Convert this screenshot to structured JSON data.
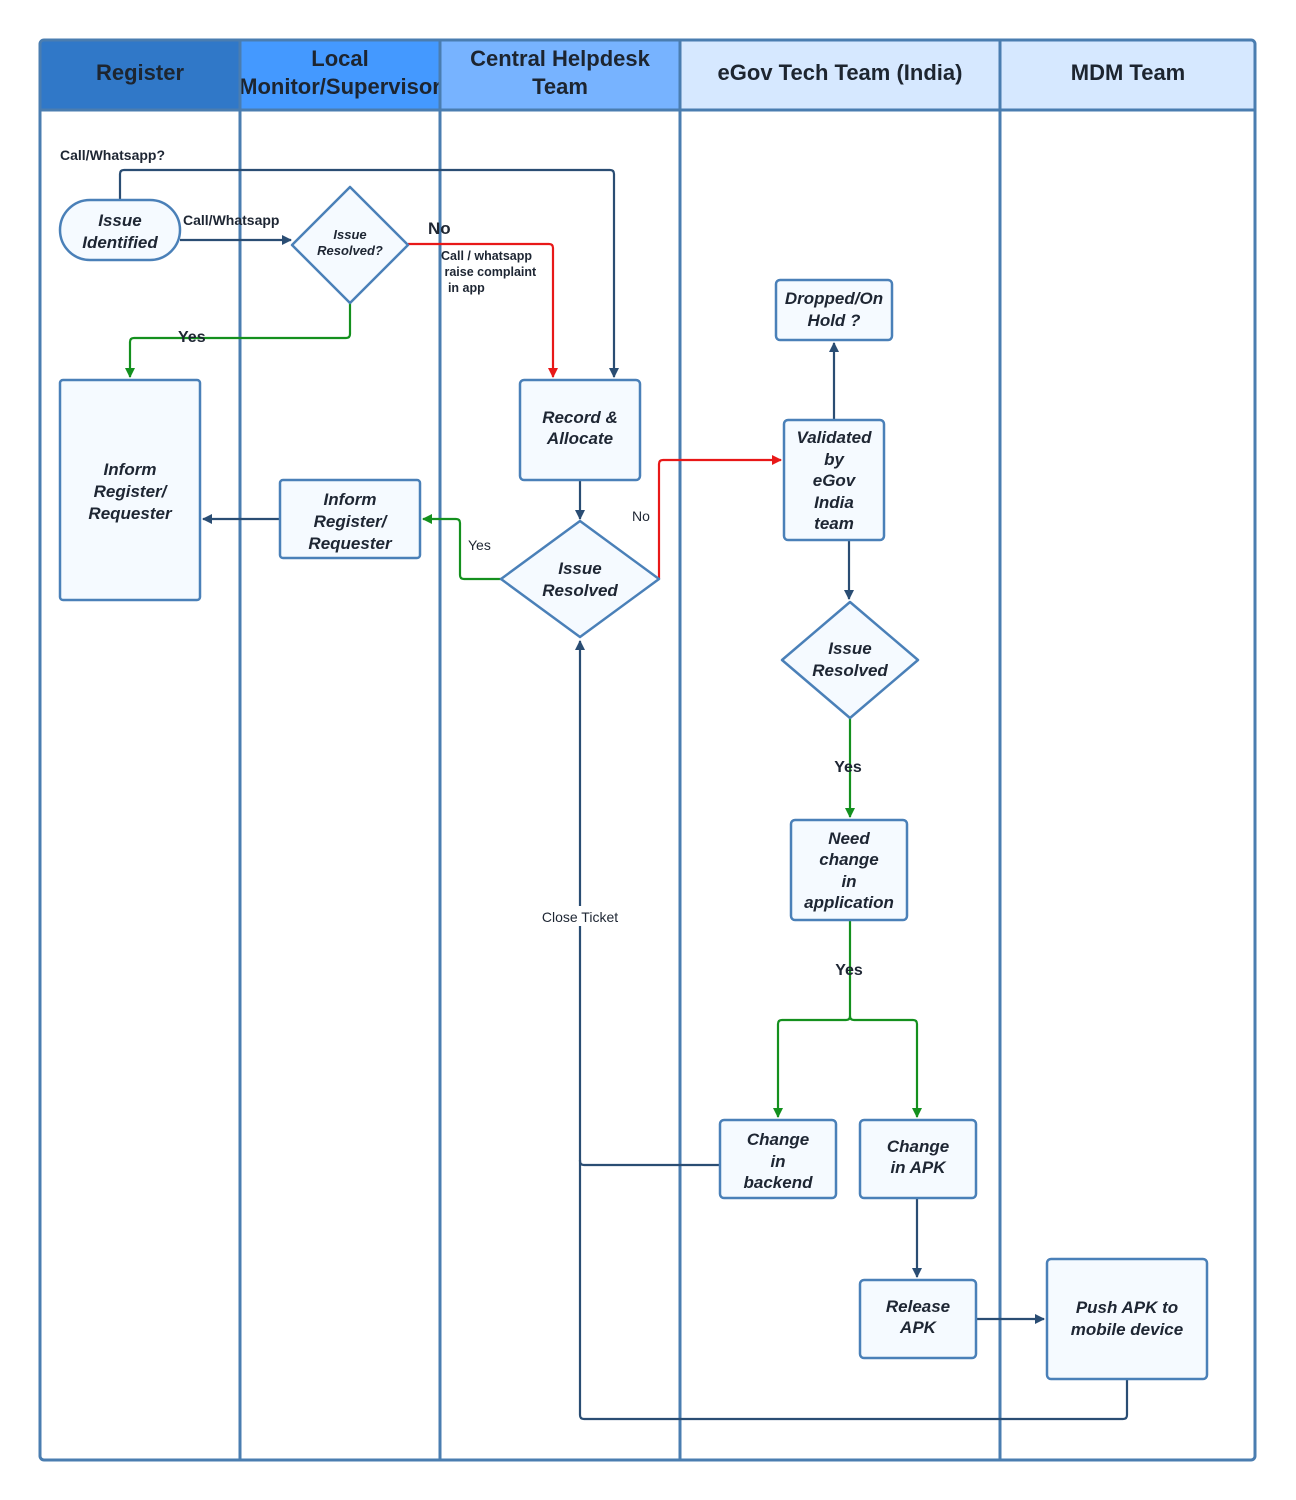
{
  "colors": {
    "header_register": "#3078C8",
    "header_local": "#4499FF",
    "header_central": "#77B3FF",
    "header_egov": "#D6E8FF",
    "header_mdm": "#D6E8FF",
    "lane_border": "#4A7DB0",
    "node_fill": "#F5FAFF",
    "connector_default": "#2A4D73",
    "connector_yes": "#14901E",
    "connector_no": "#E81818"
  },
  "lanes": [
    {
      "title_lines": [
        "Register"
      ]
    },
    {
      "title_lines": [
        "Local",
        "Monitor/Supervisor"
      ]
    },
    {
      "title_lines": [
        "Central Helpdesk",
        "Team"
      ]
    },
    {
      "title_lines": [
        "eGov Tech Team (India)"
      ]
    },
    {
      "title_lines": [
        "MDM Team"
      ]
    }
  ],
  "nodes": {
    "issue_identified": [
      "Issue",
      "Identified"
    ],
    "issue_resolved_local": [
      "Issue",
      "Resolved?"
    ],
    "inform_register_1": [
      "Inform",
      "Register/",
      "Requester"
    ],
    "record_allocate": [
      "Record &",
      "Allocate"
    ],
    "inform_register_2": [
      "Inform",
      "Register/",
      "Requester"
    ],
    "issue_resolved_central": [
      "Issue",
      "Resolved"
    ],
    "dropped_on_hold": [
      "Dropped/On",
      "Hold ?"
    ],
    "validated": [
      "Validated",
      "by",
      "eGov",
      "India",
      "team"
    ],
    "issue_resolved_egov": [
      "Issue",
      "Resolved"
    ],
    "need_change": [
      "Need",
      "change",
      "in",
      "application"
    ],
    "change_backend": [
      "Change",
      "in",
      "backend"
    ],
    "change_apk": [
      "Change",
      "in APK"
    ],
    "release_apk": [
      "Release",
      "APK"
    ],
    "push_apk": [
      "Push APK to",
      "mobile device"
    ]
  },
  "edge_labels": {
    "call_whatsapp_q": "Call/Whatsapp?",
    "call_whatsapp": "Call/Whatsapp",
    "no_local": "No",
    "raise_complaint": [
      "Call / whatsapp",
      " raise complaint",
      "  in app"
    ],
    "yes_local": "Yes",
    "yes_central": "Yes",
    "no_central": "No",
    "yes_egov": "Yes",
    "yes_need_change": "Yes",
    "close_ticket": "Close Ticket"
  }
}
